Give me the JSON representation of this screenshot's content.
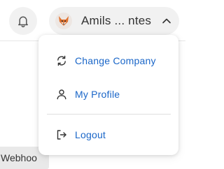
{
  "topbar": {
    "notification_icon": "bell-icon",
    "account": {
      "avatar_icon": "fox-avatar-icon",
      "name": "Amils ... ntes",
      "chevron_icon": "chevron-up-icon"
    }
  },
  "background": {
    "tab_label": "Webhoo"
  },
  "dropdown": {
    "items": [
      {
        "label": "Change Company",
        "icon": "switch-arrows-icon"
      },
      {
        "label": "My Profile",
        "icon": "user-icon"
      },
      {
        "label": "Logout",
        "icon": "logout-icon"
      }
    ]
  },
  "colors": {
    "link_blue": "#1a66c8",
    "text_dark": "#333333",
    "pill_background": "#f1f1f1"
  }
}
